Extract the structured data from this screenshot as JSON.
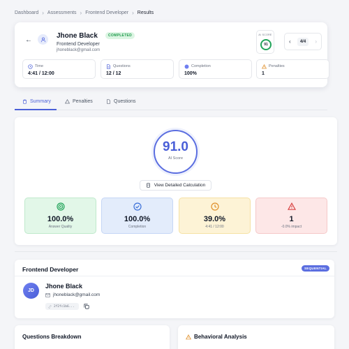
{
  "breadcrumb": [
    "Dashboard",
    "Assessments",
    "Frontend Developer",
    "Results"
  ],
  "candidate": {
    "name": "Jhone Black",
    "status": "COMPLETED",
    "role": "Frontend Developer",
    "email": "jhoneblack@gmail.com",
    "initials": "JD",
    "id_short": "2f2fc1b6..."
  },
  "ai_score_box": {
    "label": "AI SCORE",
    "value": "91"
  },
  "pager": {
    "text": "4/4",
    "prev": "‹",
    "next": "›"
  },
  "stats": [
    {
      "label": "Time",
      "value": "4:41 / 12:00",
      "icon": "clock-icon"
    },
    {
      "label": "Questions",
      "value": "12 / 12",
      "icon": "document-icon"
    },
    {
      "label": "Completion",
      "value": "100%",
      "icon": "progress-dot-icon"
    },
    {
      "label": "Penalties",
      "value": "1",
      "icon": "warning-icon"
    }
  ],
  "tabs": [
    {
      "label": "Summary",
      "icon": "clipboard-icon"
    },
    {
      "label": "Penalties",
      "icon": "warning-icon"
    },
    {
      "label": "Questions",
      "icon": "document-icon"
    }
  ],
  "summary": {
    "score": "91.0",
    "score_label": "AI Score",
    "calc_button": "View Detailed Calculation"
  },
  "metrics": [
    {
      "value": "100.0%",
      "label": "Answer Quality",
      "bg": "#e2f7e8",
      "border": "#bfe9cc",
      "color": "#22a45a",
      "icon": "target-icon"
    },
    {
      "value": "100.0%",
      "label": "Completion",
      "bg": "#e3ecfb",
      "border": "#c5d6f5",
      "color": "#3b6fd8",
      "icon": "check-circle-icon"
    },
    {
      "value": "39.0%",
      "label": "4:41 / 12:00",
      "bg": "#fdf3d6",
      "border": "#f5e1a4",
      "color": "#e0902b",
      "icon": "clock-icon"
    },
    {
      "value": "1",
      "label": "-0.0% impact",
      "bg": "#fde7e7",
      "border": "#f5c9c9",
      "color": "#d94545",
      "icon": "warning-icon"
    }
  ],
  "assessment": {
    "title": "Frontend Developer",
    "badge": "SEQUENTIAL"
  },
  "sections": {
    "questions_breakdown": "Questions Breakdown",
    "behavioral_analysis": "Behavioral Analysis"
  },
  "colors": {
    "accent": "#4a5fd8",
    "success": "#22a45a",
    "warning": "#e0902b",
    "danger": "#d94545"
  }
}
